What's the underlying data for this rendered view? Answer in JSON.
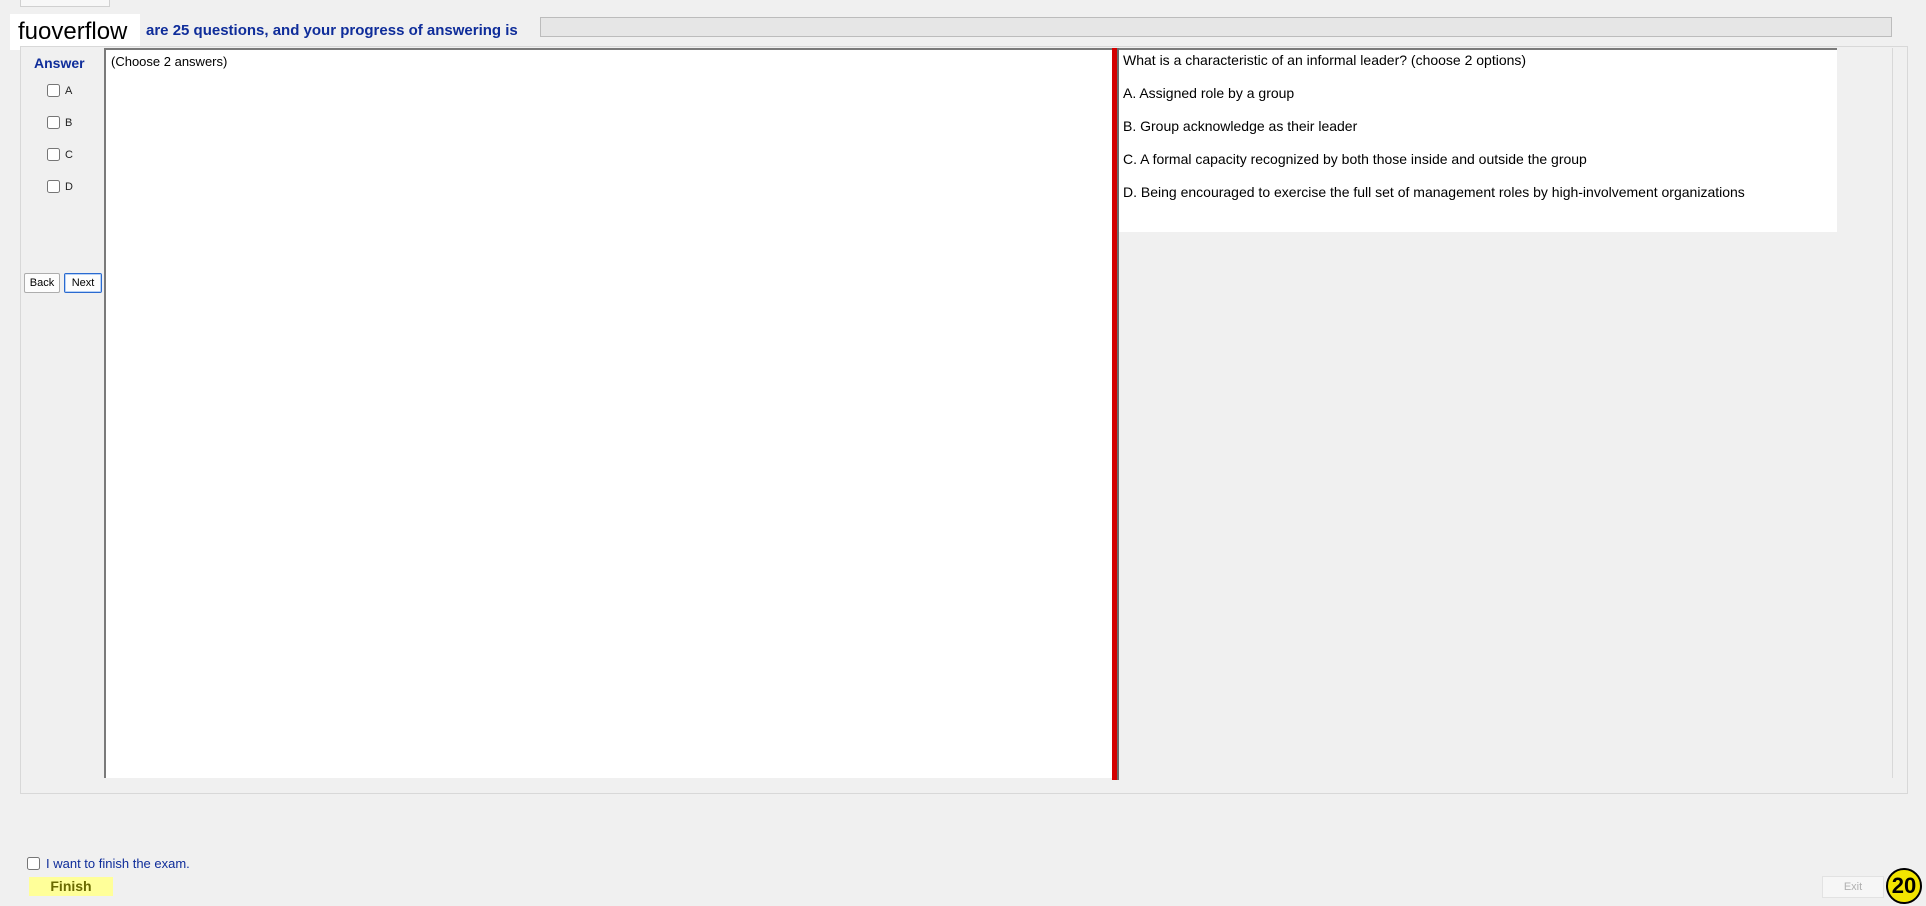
{
  "header": {
    "logo_text": "fuoverflow",
    "progress_text": "are 25 questions, and your progress of answering is",
    "progress_fraction": 0
  },
  "answer_panel": {
    "title": "Answer",
    "options": [
      {
        "label": "A",
        "checked": false
      },
      {
        "label": "B",
        "checked": false
      },
      {
        "label": "C",
        "checked": false
      },
      {
        "label": "D",
        "checked": false
      }
    ],
    "back_label": "Back",
    "next_label": "Next"
  },
  "center": {
    "instruction": "(Choose 2 answers)"
  },
  "question": {
    "text": "What is a characteristic of an informal leader? (choose 2 options)",
    "choices": [
      "A.  Assigned role by a group",
      "B.  Group acknowledge as their leader",
      "C.  A formal capacity recognized by both those inside and outside the group",
      "D.  Being encouraged to exercise the full set of management roles by high-involvement organizations"
    ]
  },
  "footer": {
    "finish_check_label": "I want to finish the exam.",
    "finish_label": "Finish",
    "exit_label": "Exit",
    "badge_text": "20"
  },
  "colors": {
    "accent_blue": "#0f2d9a",
    "splitter_red": "#d40000",
    "finish_yellow": "#ffff99",
    "badge_yellow": "#f2e400"
  }
}
